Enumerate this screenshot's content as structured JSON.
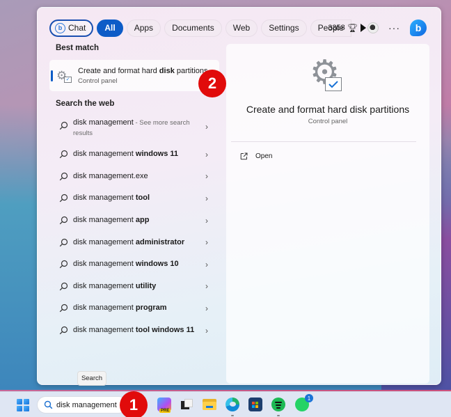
{
  "filters": {
    "chat": "Chat",
    "items": [
      "All",
      "Apps",
      "Documents",
      "Web",
      "Settings",
      "People"
    ],
    "active": "All"
  },
  "toolbar": {
    "rewards_points": "3358",
    "more_label": "···",
    "bing_label": "b"
  },
  "left": {
    "best_match_title": "Best match",
    "best_match": {
      "title_pre": "Create and format hard ",
      "title_bold": "disk",
      "title_post": " partitions",
      "subtitle": "Control panel"
    },
    "web_title": "Search the web",
    "web_results": [
      {
        "base": "disk management",
        "bold": "",
        "hint": " - See more search results"
      },
      {
        "base": "disk management ",
        "bold": "windows 11",
        "hint": ""
      },
      {
        "base": "disk management.exe",
        "bold": "",
        "hint": ""
      },
      {
        "base": "disk management ",
        "bold": "tool",
        "hint": ""
      },
      {
        "base": "disk management ",
        "bold": "app",
        "hint": ""
      },
      {
        "base": "disk management ",
        "bold": "administrator",
        "hint": ""
      },
      {
        "base": "disk management ",
        "bold": "windows 10",
        "hint": ""
      },
      {
        "base": "disk management ",
        "bold": "utility",
        "hint": ""
      },
      {
        "base": "disk management ",
        "bold": "program",
        "hint": ""
      },
      {
        "base": "disk management ",
        "bold": "tool windows 11",
        "hint": ""
      }
    ]
  },
  "detail": {
    "title": "Create and format hard disk partitions",
    "subtitle": "Control panel",
    "actions": [
      {
        "label": "Open",
        "icon": "open-external-icon"
      }
    ]
  },
  "annotations": {
    "step1": "1",
    "step2": "2"
  },
  "tooltip": "Search",
  "taskbar": {
    "search_value": "disk management",
    "copilot_badge": "PRE",
    "whatsapp_badge": "1",
    "apps": [
      "copilot",
      "task-view",
      "file-explorer",
      "edge",
      "microsoft-store",
      "spotify",
      "whatsapp"
    ]
  },
  "colors": {
    "accent": "#0d5cc7",
    "annotation_red": "#e10b0b"
  }
}
